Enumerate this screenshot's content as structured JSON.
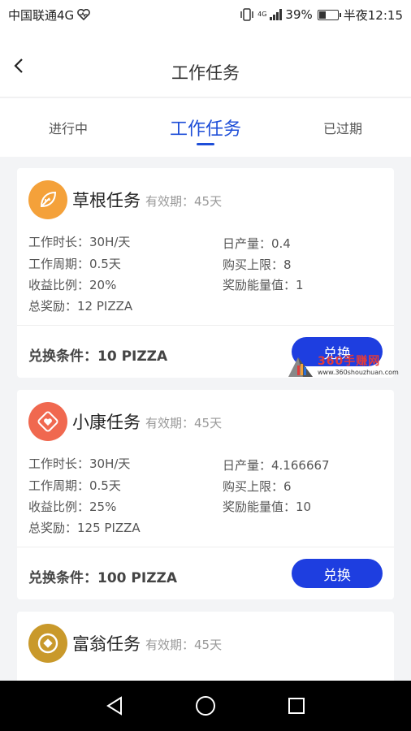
{
  "status_bar": {
    "carrier": "中国联通4G",
    "network_badge": "4G",
    "battery_percent": "39%",
    "battery_level": 0.39,
    "time": "半夜12:15"
  },
  "header": {
    "title": "工作任务",
    "back_icon": "chevron-left-icon"
  },
  "tabs": [
    {
      "label": "进行中",
      "active": false
    },
    {
      "label": "工作任务",
      "active": true
    },
    {
      "label": "已过期",
      "active": false
    }
  ],
  "tasks": [
    {
      "name": "草根任务",
      "validity": "有效期：45天",
      "icon": "leaf-icon",
      "icon_color": "#f4a13a",
      "fields": {
        "duration": "工作时长：30H/天",
        "daily_output": "日产量：0.4",
        "cycle": "工作周期：0.5天",
        "purchase_limit": "购买上限：8",
        "yield_ratio": "收益比例：20%",
        "energy_reward": "奖励能量值：1",
        "total_reward": "总奖励：12 PIZZA"
      },
      "condition": "兑换条件：10 PIZZA",
      "button_label": "兑换"
    },
    {
      "name": "小康任务",
      "validity": "有效期：45天",
      "icon": "heart-icon",
      "icon_color": "#f0684f",
      "fields": {
        "duration": "工作时长：30H/天",
        "daily_output": "日产量：4.166667",
        "cycle": "工作周期：0.5天",
        "purchase_limit": "购买上限：6",
        "yield_ratio": "收益比例：25%",
        "energy_reward": "奖励能量值：10",
        "total_reward": "总奖励：125 PIZZA"
      },
      "condition": "兑换条件：100 PIZZA",
      "button_label": "兑换"
    },
    {
      "name": "富翁任务",
      "validity": "有效期：45天",
      "icon": "coin-icon",
      "icon_color": "#c9992b"
    }
  ],
  "watermark": {
    "text": "360手赚网",
    "url": "www.360shouzhuan.com"
  },
  "colors": {
    "accent": "#1e4ed8",
    "button": "#1e3ee0"
  }
}
